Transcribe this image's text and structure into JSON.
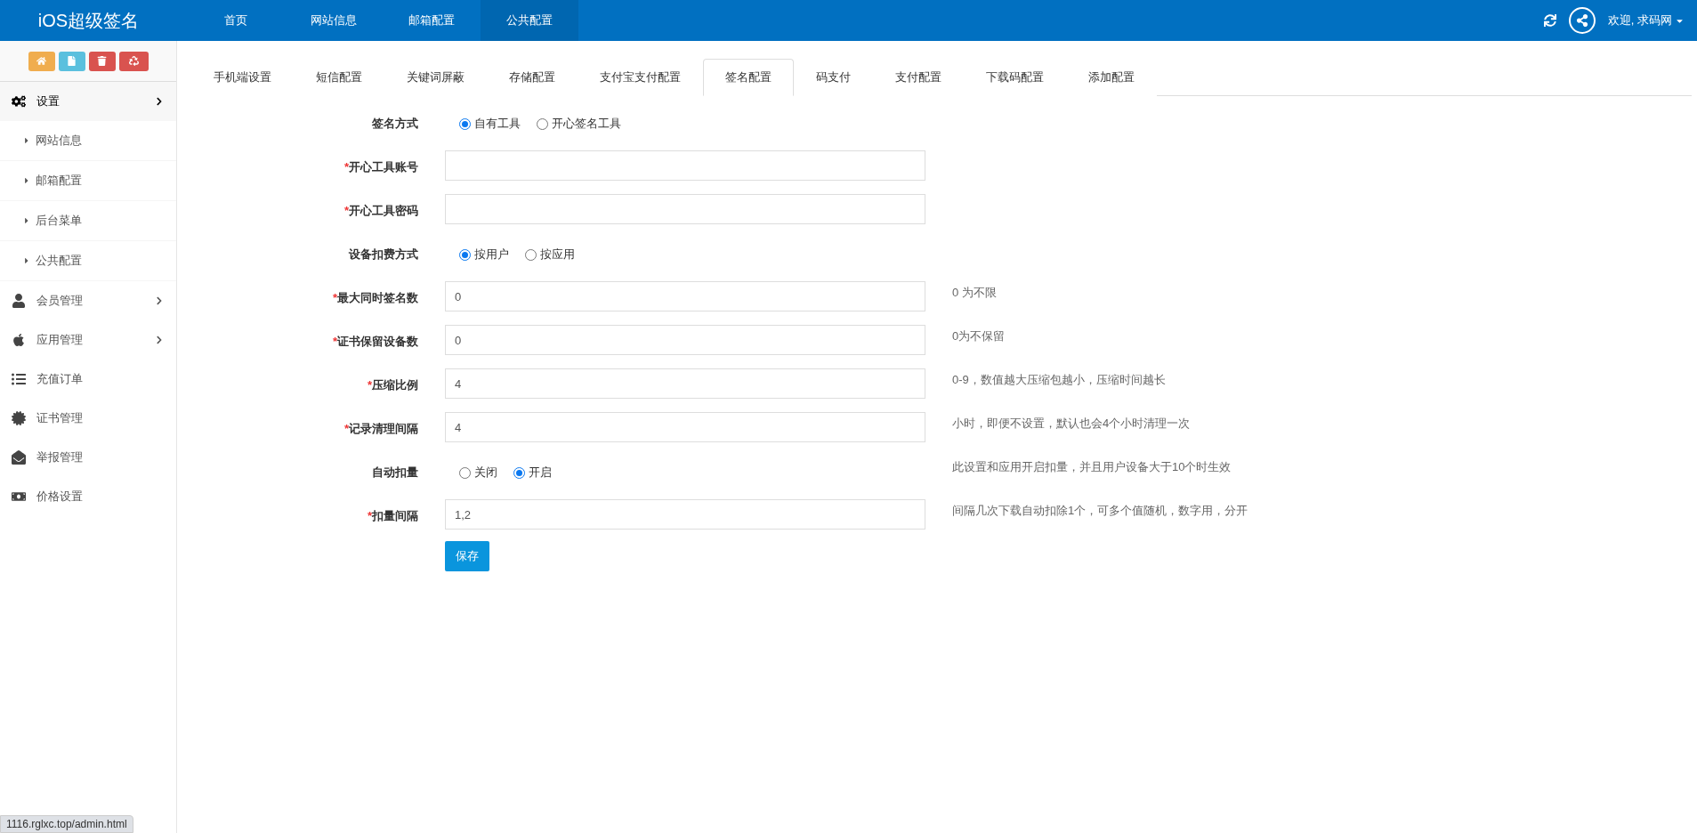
{
  "header": {
    "brand": "iOS超级签名",
    "nav": [
      {
        "label": "首页",
        "selected": false
      },
      {
        "label": "网站信息",
        "selected": false
      },
      {
        "label": "邮箱配置",
        "selected": false
      },
      {
        "label": "公共配置",
        "selected": true
      }
    ],
    "user": "欢迎, 求码网"
  },
  "sidebar": {
    "menu": [
      {
        "label": "设置",
        "has_arrow": true,
        "expanded": true,
        "children": [
          {
            "label": "网站信息"
          },
          {
            "label": "邮箱配置"
          },
          {
            "label": "后台菜单"
          },
          {
            "label": "公共配置"
          }
        ]
      },
      {
        "label": "会员管理",
        "has_arrow": true,
        "expanded": false
      },
      {
        "label": "应用管理",
        "has_arrow": true,
        "expanded": false
      },
      {
        "label": "充值订单",
        "has_arrow": false,
        "expanded": false
      },
      {
        "label": "证书管理",
        "has_arrow": false,
        "expanded": false
      },
      {
        "label": "举报管理",
        "has_arrow": false,
        "expanded": false
      },
      {
        "label": "价格设置",
        "has_arrow": false,
        "expanded": false
      }
    ]
  },
  "tabs": [
    {
      "label": "手机端设置",
      "selected": false
    },
    {
      "label": "短信配置",
      "selected": false
    },
    {
      "label": "关键词屏蔽",
      "selected": false
    },
    {
      "label": "存储配置",
      "selected": false
    },
    {
      "label": "支付宝支付配置",
      "selected": false
    },
    {
      "label": "签名配置",
      "selected": true
    },
    {
      "label": "码支付",
      "selected": false
    },
    {
      "label": "支付配置",
      "selected": false
    },
    {
      "label": "下载码配置",
      "selected": false
    },
    {
      "label": "添加配置",
      "selected": false
    }
  ],
  "form": {
    "rows": [
      {
        "kind": "radio",
        "label": "签名方式",
        "required": false,
        "options": [
          {
            "label": "自有工具",
            "selected": true
          },
          {
            "label": "开心签名工具",
            "selected": false
          }
        ]
      },
      {
        "kind": "text",
        "label": "开心工具账号",
        "required": true
      },
      {
        "kind": "text",
        "label": "开心工具密码",
        "required": true
      },
      {
        "kind": "radio",
        "label": "设备扣费方式",
        "required": false,
        "options": [
          {
            "label": "按用户",
            "selected": true
          },
          {
            "label": "按应用",
            "selected": false
          }
        ]
      },
      {
        "kind": "text",
        "label": "最大同时签名数",
        "required": true,
        "value": "0",
        "hint": "0 为不限"
      },
      {
        "kind": "text",
        "label": "证书保留设备数",
        "required": true,
        "value": "0",
        "hint": "0为不保留"
      },
      {
        "kind": "text",
        "label": "压缩比例",
        "required": true,
        "value": "4",
        "hint": "0-9，数值越大压缩包越小，压缩时间越长"
      },
      {
        "kind": "text",
        "label": "记录清理间隔",
        "required": true,
        "value": "4",
        "hint": "小时，即便不设置，默认也会4个小时清理一次"
      },
      {
        "kind": "radio",
        "label": "自动扣量",
        "required": false,
        "options": [
          {
            "label": "关闭",
            "selected": false
          },
          {
            "label": "开启",
            "selected": true
          }
        ],
        "hint": "此设置和应用开启扣量，并且用户设备大于10个时生效"
      },
      {
        "kind": "text",
        "label": "扣量间隔",
        "required": true,
        "value": "1,2",
        "hint": "间隔几次下载自动扣除1个，可多个值随机，数字用，分开"
      }
    ],
    "required_mark": "*",
    "submit": "保存"
  },
  "status_bar": {
    "url": "1116.rglxc.top/admin.html"
  }
}
